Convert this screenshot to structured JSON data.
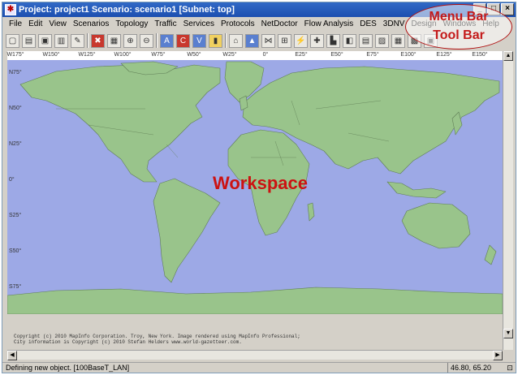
{
  "window": {
    "title": "Project: project1 Scenario: scenario1  [Subnet: top]",
    "app_icon": "app-icon",
    "min_label": "_",
    "max_label": "□",
    "close_label": "×"
  },
  "menu": [
    "File",
    "Edit",
    "View",
    "Scenarios",
    "Topology",
    "Traffic",
    "Services",
    "Protocols",
    "NetDoctor",
    "Flow Analysis",
    "DES",
    "3DNV",
    "Design",
    "Windows",
    "Help"
  ],
  "toolbar": {
    "icons": [
      {
        "name": "new-project-icon",
        "glyph": "▢"
      },
      {
        "name": "open-folder-icon",
        "glyph": "▤"
      },
      {
        "name": "save-icon",
        "glyph": "▣"
      },
      {
        "name": "print-icon",
        "glyph": "▥"
      },
      {
        "name": "object-palette-icon",
        "glyph": "✎"
      },
      {
        "name": "delete-icon",
        "glyph": "✖"
      },
      {
        "name": "properties-icon",
        "glyph": "▦"
      },
      {
        "name": "zoom-in-icon",
        "glyph": "⊕"
      },
      {
        "name": "zoom-out-icon",
        "glyph": "⊖"
      },
      {
        "name": "traffic-ace-icon",
        "glyph": "A"
      },
      {
        "name": "traffic-cfg-icon",
        "glyph": "C"
      },
      {
        "name": "traffic-vne-icon",
        "glyph": "V"
      },
      {
        "name": "flow-icon",
        "glyph": "▮"
      },
      {
        "name": "topology-icon",
        "glyph": "⌂"
      },
      {
        "name": "triangle-icon",
        "glyph": "▲"
      },
      {
        "name": "links-icon",
        "glyph": "⋈"
      },
      {
        "name": "subnet-icon",
        "glyph": "⊞"
      },
      {
        "name": "fail-link-icon",
        "glyph": "⚡"
      },
      {
        "name": "recover-link-icon",
        "glyph": "✚"
      },
      {
        "name": "chart-icon",
        "glyph": "▙"
      },
      {
        "name": "configure-sim-icon",
        "glyph": "◧"
      },
      {
        "name": "view-results-icon",
        "glyph": "▤"
      },
      {
        "name": "graph-icon",
        "glyph": "▨"
      },
      {
        "name": "table-icon",
        "glyph": "▦"
      },
      {
        "name": "hide-graphs-icon",
        "glyph": "▩"
      },
      {
        "name": "report-icon",
        "glyph": "▣"
      }
    ]
  },
  "annotation": {
    "line1": "Menu Bar",
    "line2": "Tool Bar"
  },
  "map": {
    "longitude_ticks": [
      "W175°",
      "W150°",
      "W125°",
      "W100°",
      "W75°",
      "W50°",
      "W25°",
      "0°",
      "E25°",
      "E50°",
      "E75°",
      "E100°",
      "E125°",
      "E150°"
    ],
    "latitude_ticks": [
      "N75°",
      "N50°",
      "N25°",
      "0°",
      "S25°",
      "S50°",
      "S75°"
    ],
    "workspace_label": "Workspace",
    "ocean_color": "#9da9e6",
    "land_color": "#99c48b",
    "border_color": "#5f7d56"
  },
  "copyright": {
    "line1": "Copyright (c) 2010 MapInfo Corporation. Troy, New York. Image rendered using MapInfo Professional;",
    "line2": "City information is Copyright (c) 2010 Stefan Helders www.world-gazetteer.com."
  },
  "status": {
    "message": "Defining new object. [100BaseT_LAN]",
    "coordinates": "46.80, 65.20"
  }
}
